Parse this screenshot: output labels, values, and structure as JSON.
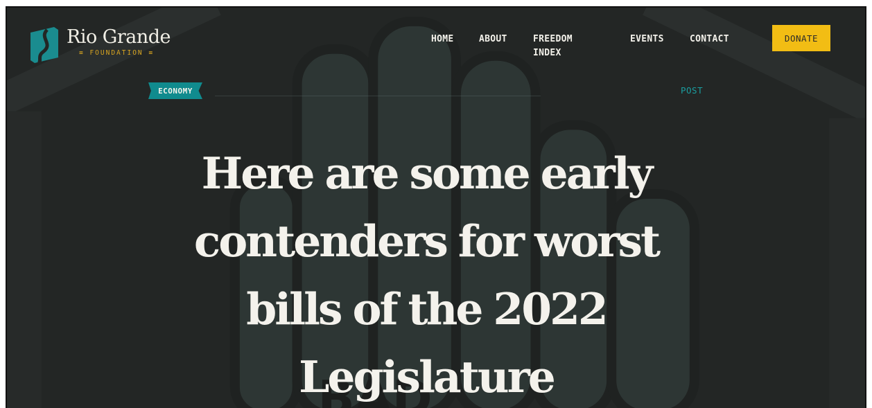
{
  "logo": {
    "name": "Rio Grande",
    "subtitle": "≡ FOUNDATION ≡"
  },
  "nav": {
    "items": [
      {
        "label": "HOME"
      },
      {
        "label": "ABOUT"
      },
      {
        "label": "FREEDOM INDEX"
      },
      {
        "label": "EVENTS"
      },
      {
        "label": "CONTACT"
      }
    ],
    "donate_label": "DONATE"
  },
  "article": {
    "category": "ECONOMY",
    "post_type": "POST",
    "headline": "Here are some early contenders for worst bills of the 2022 Legislature"
  },
  "colors": {
    "background": "#232625",
    "accent_teal": "#108b8e",
    "donate_yellow": "#f2bd14",
    "logo_gold": "#d9a520",
    "text": "#f4f2ec"
  },
  "icons": {
    "logo_mark": "rio-grande-logo-icon"
  }
}
